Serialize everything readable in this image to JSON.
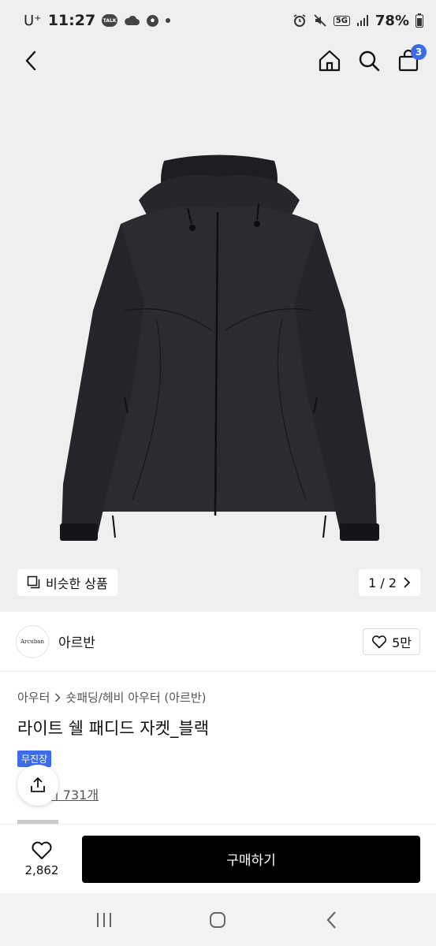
{
  "status_bar": {
    "carrier": "U⁺",
    "time": "11:27",
    "talk_label": "TALK",
    "network_label": "5G",
    "battery": "78%"
  },
  "nav": {
    "cart_count": "3"
  },
  "gallery": {
    "similar_label": "비슷한 상품",
    "page_indicator": "1 / 2"
  },
  "brand": {
    "logo_text": "Arcuban",
    "name": "아르반",
    "like_count": "5만"
  },
  "product": {
    "category_parent": "아우터",
    "category_child": "숏패딩/헤비 아우터 (아르반)",
    "title": "라이트 쉘 패디드 자켓_블랙",
    "tag": "무진장",
    "review_text": "기 731개"
  },
  "bottom_bar": {
    "wish_count": "2,862",
    "buy_label": "구매하기"
  },
  "colors": {
    "accent_blue": "#3d6be8",
    "buy_button": "#000000",
    "image_bg": "#efefef"
  }
}
